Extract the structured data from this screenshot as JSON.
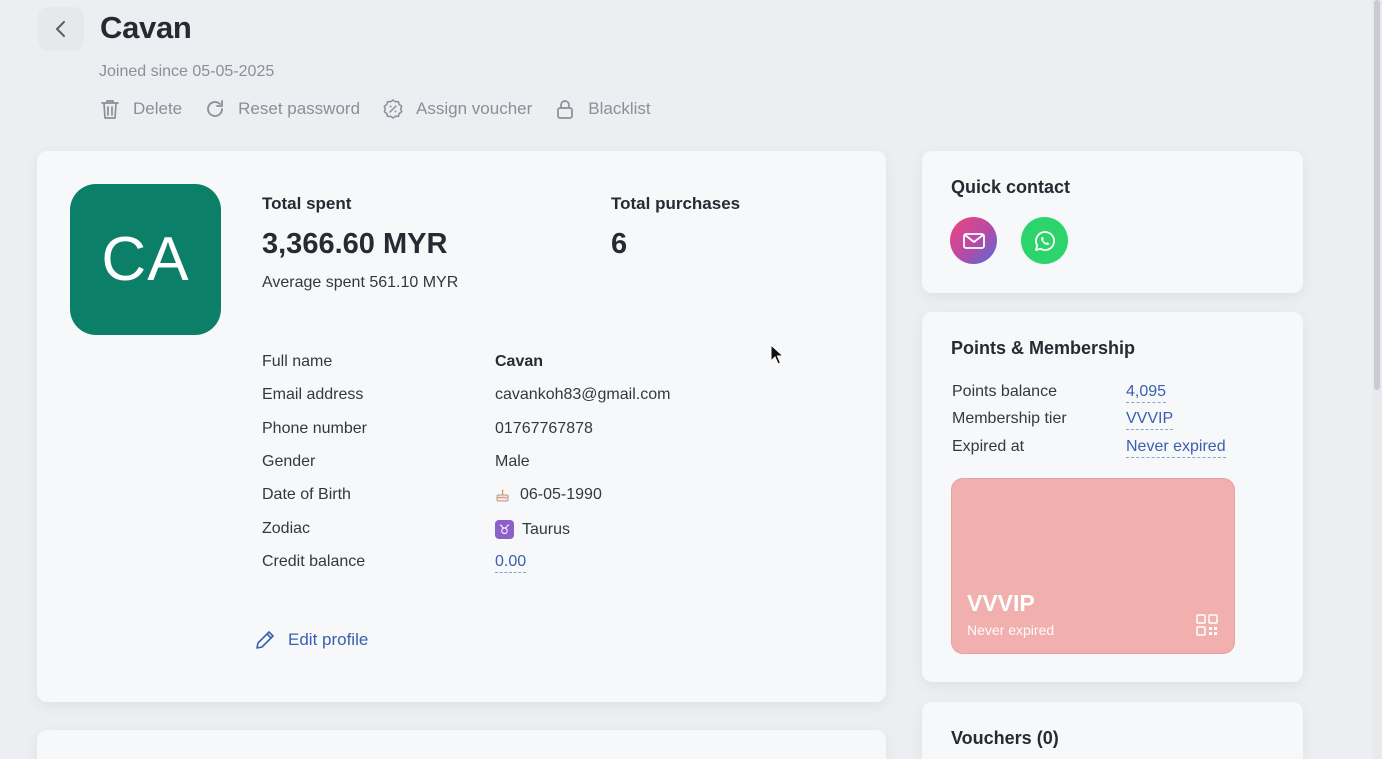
{
  "header": {
    "title": "Cavan",
    "joined": "Joined since 05-05-2025",
    "actions": [
      {
        "label": "Delete",
        "icon": "trash-icon"
      },
      {
        "label": "Reset password",
        "icon": "refresh-icon"
      },
      {
        "label": "Assign voucher",
        "icon": "voucher-badge-icon"
      },
      {
        "label": "Blacklist",
        "icon": "lock-icon"
      }
    ]
  },
  "profile": {
    "initials": "CA",
    "avatar_color": "#0b7f67",
    "total_spent_label": "Total spent",
    "total_spent_value": "3,366.60 MYR",
    "average_spent": "Average spent 561.10 MYR",
    "total_purchases_label": "Total purchases",
    "total_purchases_value": "6",
    "fields": [
      {
        "label": "Full name",
        "value": "Cavan"
      },
      {
        "label": "Email address",
        "value": "cavankoh83@gmail.com"
      },
      {
        "label": "Phone number",
        "value": "01767767878"
      },
      {
        "label": "Gender",
        "value": "Male"
      },
      {
        "label": "Date of Birth",
        "value": "06-05-1990",
        "icon": "cake-icon"
      },
      {
        "label": "Zodiac",
        "value": "Taurus",
        "icon": "taurus-icon"
      },
      {
        "label": "Credit balance",
        "value": "0.00"
      }
    ],
    "edit_label": "Edit profile"
  },
  "quick_contact": {
    "title": "Quick contact",
    "buttons": [
      {
        "icon": "email-icon",
        "color": "#e0457b"
      },
      {
        "icon": "whatsapp-icon",
        "color": "#25d366"
      }
    ]
  },
  "membership": {
    "title": "Points & Membership",
    "rows": [
      {
        "label": "Points balance",
        "value": "4,095"
      },
      {
        "label": "Membership tier",
        "value": "VVVIP"
      },
      {
        "label": "Expired at",
        "value": "Never expired"
      }
    ],
    "card": {
      "tier": "VVVIP",
      "expiry": "Never expired",
      "color": "#f1b0ad"
    }
  },
  "vouchers": {
    "title": "Vouchers (0)"
  },
  "colors": {
    "accent_link": "#3a5fb0",
    "background": "#eceef1",
    "card": "#f7f8f9"
  }
}
